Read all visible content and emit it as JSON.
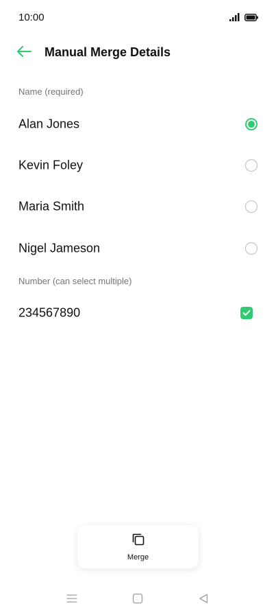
{
  "status_bar": {
    "time": "10:00"
  },
  "header": {
    "title": "Manual Merge Details"
  },
  "name_section": {
    "title": "Name (required)",
    "options": [
      {
        "label": "Alan Jones",
        "selected": true
      },
      {
        "label": "Kevin Foley",
        "selected": false
      },
      {
        "label": "Maria Smith",
        "selected": false
      },
      {
        "label": "Nigel Jameson",
        "selected": false
      }
    ]
  },
  "number_section": {
    "title": "Number (can select multiple)",
    "options": [
      {
        "label": "234567890",
        "checked": true
      }
    ]
  },
  "merge_button": {
    "label": "Merge"
  },
  "colors": {
    "accent": "#2ecc71",
    "text": "#111111",
    "secondary": "#757575"
  }
}
